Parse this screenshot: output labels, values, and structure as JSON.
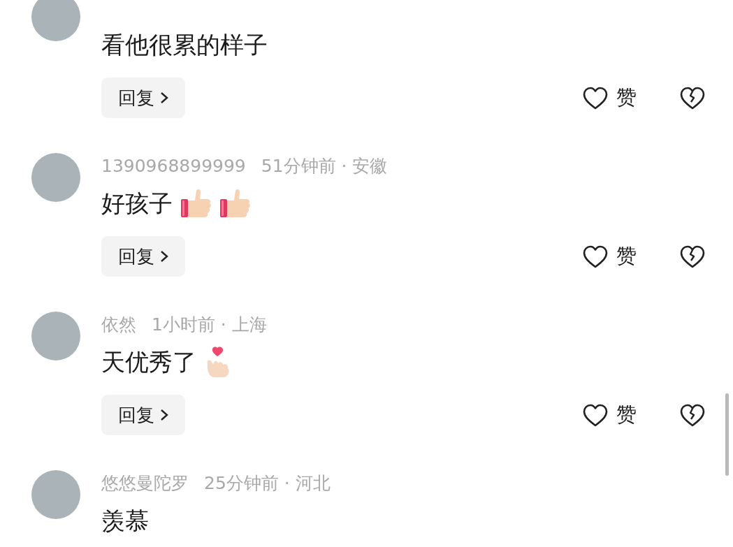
{
  "comments": [
    {
      "text": "看他很累的样子",
      "reply_label": "回复",
      "like_label": "赞"
    },
    {
      "user": "1390968899999",
      "time_location": "51分钟前 · 安徽",
      "text": "好孩子",
      "stickers": [
        {
          "kind": "thumbs-up"
        },
        {
          "kind": "thumbs-up"
        }
      ],
      "reply_label": "回复",
      "like_label": "赞"
    },
    {
      "user": "依然",
      "time_location": "1小时前 · 上海",
      "text": "天优秀了",
      "stickers": [
        {
          "kind": "finger-heart"
        }
      ],
      "reply_label": "回复",
      "like_label": "赞"
    },
    {
      "user": "悠悠曼陀罗",
      "time_location": "25分钟前 · 河北",
      "text": "羡慕"
    }
  ]
}
